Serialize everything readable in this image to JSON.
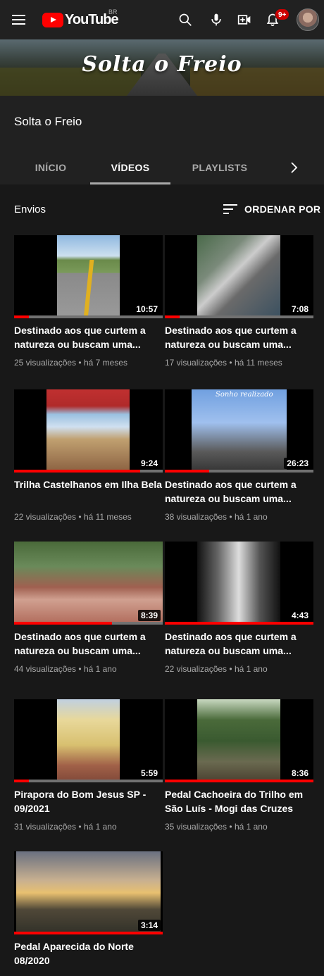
{
  "topbar": {
    "logo_text": "YouTube",
    "region": "BR",
    "notification_count": "9+",
    "icons": [
      "menu-icon",
      "search-icon",
      "mic-icon",
      "create-video-icon",
      "bell-icon",
      "avatar"
    ]
  },
  "banner": {
    "title": "Solta o Freio"
  },
  "channel": {
    "name": "Solta o Freio",
    "tabs": [
      {
        "label": "INÍCIO",
        "active": false
      },
      {
        "label": "VÍDEOS",
        "active": true
      },
      {
        "label": "PLAYLISTS",
        "active": false
      }
    ]
  },
  "section": {
    "title": "Envios",
    "sort_label": "ORDENAR POR"
  },
  "videos": [
    {
      "title": "Destinado aos que curtem a natureza ou buscam uma...",
      "duration": "10:57",
      "views": "25 visualizações",
      "age": "há 7 meses",
      "watched": 0.1,
      "art": "road"
    },
    {
      "title": "Destinado aos que curtem a natureza ou buscam uma...",
      "duration": "7:08",
      "views": "17 visualizações",
      "age": "há 11 meses",
      "watched": 0.1,
      "art": "falls"
    },
    {
      "title": "Trilha Castelhanos em Ilha Bela",
      "duration": "9:24",
      "views": "22 visualizações",
      "age": "há 11 meses",
      "watched": 0.85,
      "art": "beach"
    },
    {
      "title": "Destinado aos que curtem a natureza ou buscam uma...",
      "duration": "26:23",
      "views": "38 visualizações",
      "age": "há 1 ano",
      "watched": 0.3,
      "art": "bikers",
      "overlay": "Sonho realizado"
    },
    {
      "title": "Destinado aos que curtem a natureza ou buscam uma...",
      "duration": "8:39",
      "views": "44 visualizações",
      "age": "há 1 ano",
      "watched": 0.66,
      "art": "rock"
    },
    {
      "title": "Destinado aos que curtem a natureza ou buscam uma...",
      "duration": "4:43",
      "views": "22 visualizações",
      "age": "há 1 ano",
      "watched": 1.0,
      "art": "bw"
    },
    {
      "title": "Pirapora do Bom Jesus SP - 09/2021",
      "duration": "5:59",
      "views": "31 visualizações",
      "age": "há 1 ano",
      "watched": 0.1,
      "art": "church"
    },
    {
      "title": "Pedal Cachoeira do Trilho em São Luís - Mogi das Cruzes",
      "duration": "8:36",
      "views": "35 visualizações",
      "age": "há 1 ano",
      "watched": 1.0,
      "art": "forest"
    },
    {
      "title": "Pedal Aparecida do Norte 08/2020",
      "duration": "3:14",
      "views": "",
      "age": "",
      "watched": 1.0,
      "art": "sunset"
    }
  ],
  "colors": {
    "background": "#181818",
    "header": "#212121",
    "accent_red": "#ff0000",
    "meta_text": "#aaaaaa"
  }
}
